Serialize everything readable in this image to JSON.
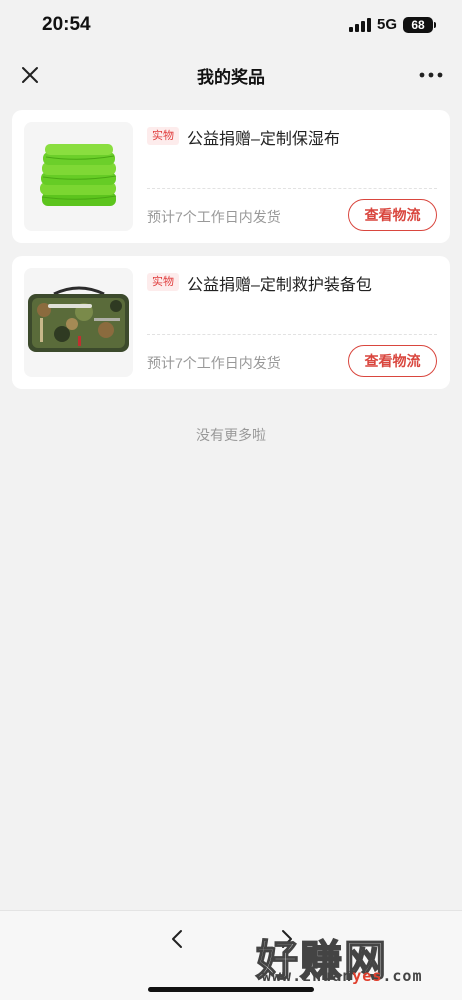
{
  "status_bar": {
    "time": "20:54",
    "network": "5G",
    "battery": "68"
  },
  "nav": {
    "title": "我的奖品",
    "close_icon": "close-icon",
    "more_icon": "more-icon"
  },
  "prizes": [
    {
      "tag": "实物",
      "title": "公益捐赠–定制保湿布",
      "ship_note": "预计7个工作日内发货",
      "button_label": "查看物流",
      "image": "green-towel-stack"
    },
    {
      "tag": "实物",
      "title": "公益捐赠–定制救护装备包",
      "ship_note": "预计7个工作日内发货",
      "button_label": "查看物流",
      "image": "camouflage-rescue-bag"
    }
  ],
  "footer_text": "没有更多啦",
  "toolbar": {
    "back_icon": "chevron-left-icon",
    "forward_icon": "chevron-right-icon"
  },
  "watermark": {
    "brand": "好赚网",
    "url_prefix": "www.zhuan",
    "url_accent": "yes",
    "url_suffix": ".com"
  },
  "colors": {
    "accent": "#d9463e",
    "tag_bg": "#fdecec",
    "background": "#f2f2f2"
  }
}
